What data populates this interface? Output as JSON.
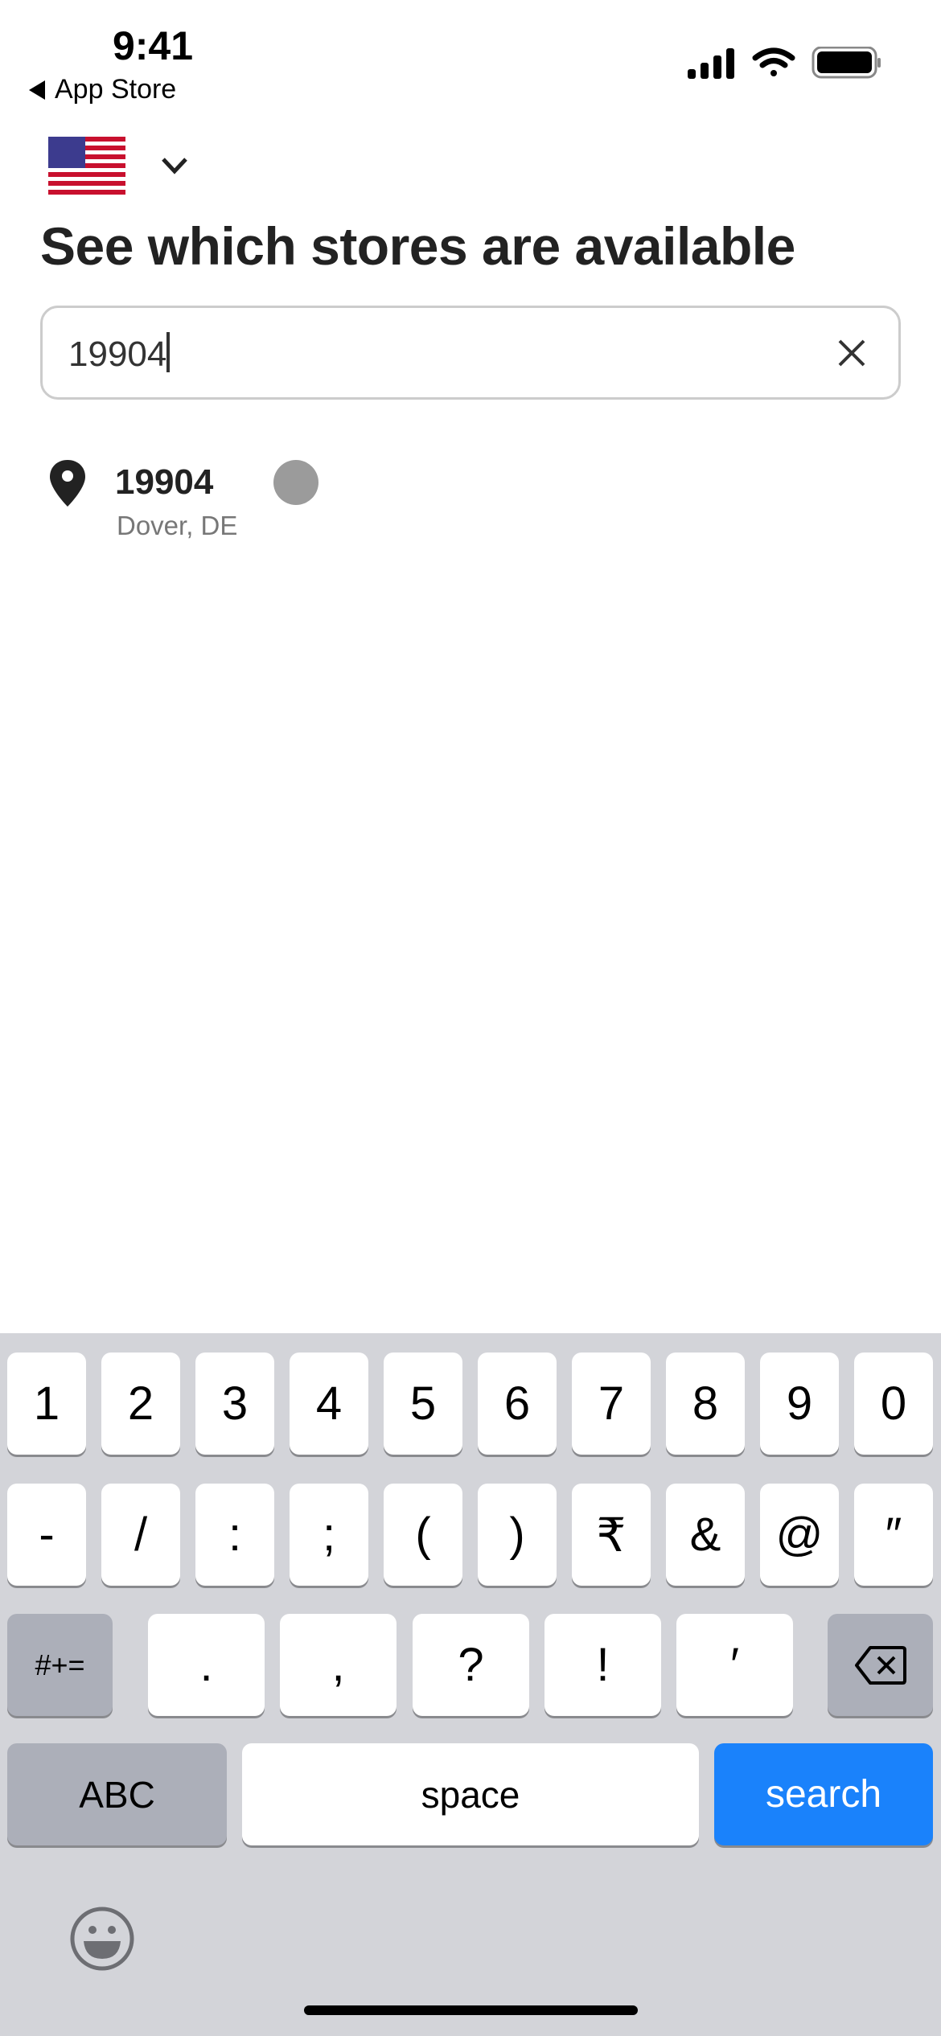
{
  "status_bar": {
    "time": "9:41",
    "back_label": "App Store"
  },
  "country": {
    "flag": "US",
    "chevron": "chevron-down-icon"
  },
  "title": "See which stores are available",
  "search": {
    "value": "19904"
  },
  "results": [
    {
      "title": "19904",
      "subtitle": "Dover, DE"
    }
  ],
  "keyboard": {
    "row1": [
      "1",
      "2",
      "3",
      "4",
      "5",
      "6",
      "7",
      "8",
      "9",
      "0"
    ],
    "row2": [
      "-",
      "/",
      ":",
      ";",
      "(",
      ")",
      "₹",
      "&",
      "@",
      "″"
    ],
    "row3": {
      "shift": "#+=",
      "keys": [
        ".",
        ",",
        "?",
        "!",
        "′"
      ]
    },
    "abc": "ABC",
    "space": "space",
    "search": "search",
    "accent": "#1a82fb"
  }
}
